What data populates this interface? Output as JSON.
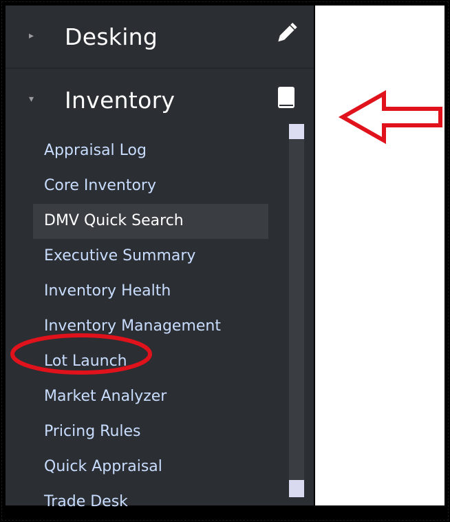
{
  "sidebar": {
    "sections": [
      {
        "label": "Desking",
        "expanded": false,
        "icon": "pencil-icon"
      },
      {
        "label": "Inventory",
        "expanded": true,
        "icon": "book-icon"
      }
    ],
    "inventory_items": [
      {
        "label": "Appraisal Log"
      },
      {
        "label": "Core Inventory"
      },
      {
        "label": "DMV Quick Search",
        "active": true
      },
      {
        "label": "Executive Summary"
      },
      {
        "label": "Inventory Health"
      },
      {
        "label": "Inventory Management"
      },
      {
        "label": "Lot Launch",
        "annotated": true
      },
      {
        "label": "Market Analyzer"
      },
      {
        "label": "Pricing Rules"
      },
      {
        "label": "Quick Appraisal"
      },
      {
        "label": "Trade Desk"
      }
    ]
  },
  "colors": {
    "sidebar_bg": "#2b2e33",
    "item_text": "#c9ddff",
    "active_bg": "#3a3d42",
    "annotation": "#e0121b"
  }
}
